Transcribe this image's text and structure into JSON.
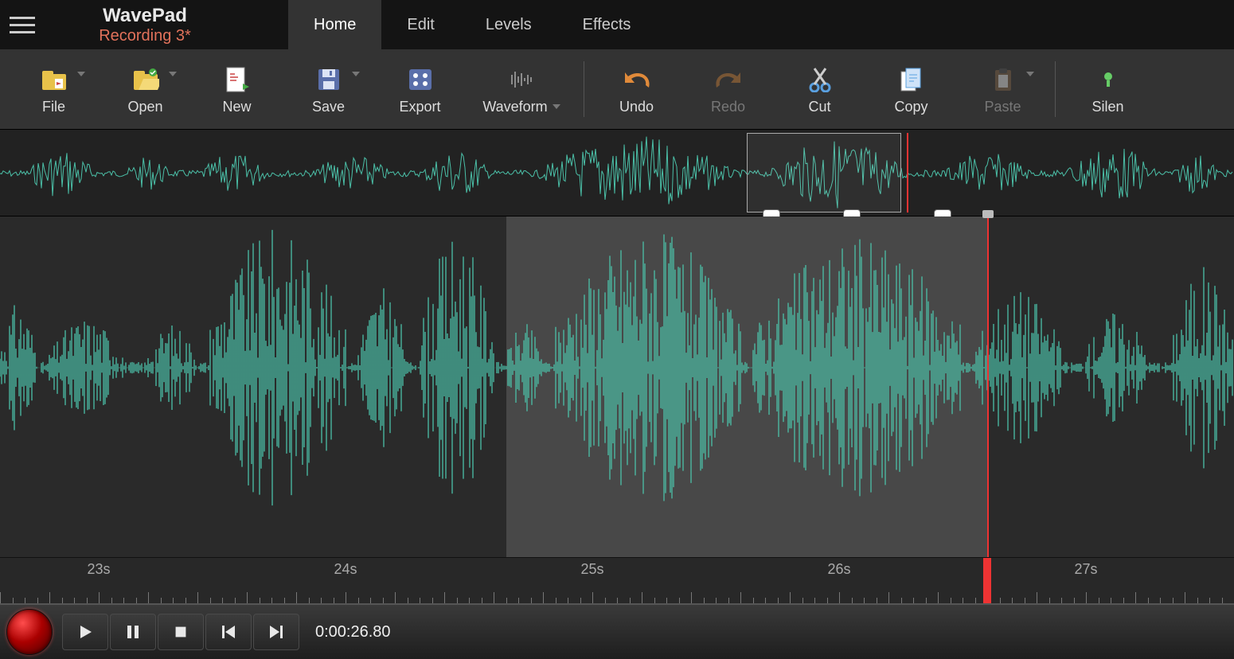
{
  "app": {
    "title": "WavePad",
    "document": "Recording 3*"
  },
  "tabs": [
    {
      "label": "Home",
      "active": true
    },
    {
      "label": "Edit",
      "active": false
    },
    {
      "label": "Levels",
      "active": false
    },
    {
      "label": "Effects",
      "active": false
    }
  ],
  "toolbar": [
    {
      "id": "file",
      "label": "File",
      "icon": "file-icon",
      "dropdown": true,
      "enabled": true
    },
    {
      "id": "open",
      "label": "Open",
      "icon": "open-icon",
      "dropdown": true,
      "enabled": true
    },
    {
      "id": "new",
      "label": "New",
      "icon": "new-icon",
      "dropdown": false,
      "enabled": true
    },
    {
      "id": "save",
      "label": "Save",
      "icon": "save-icon",
      "dropdown": true,
      "enabled": true
    },
    {
      "id": "export",
      "label": "Export",
      "icon": "export-icon",
      "dropdown": false,
      "enabled": true
    },
    {
      "id": "waveform",
      "label": "Waveform",
      "icon": "waveform-icon",
      "dropdown": true,
      "enabled": true,
      "inlineDrop": true
    },
    {
      "sep": true
    },
    {
      "id": "undo",
      "label": "Undo",
      "icon": "undo-icon",
      "dropdown": false,
      "enabled": true
    },
    {
      "id": "redo",
      "label": "Redo",
      "icon": "redo-icon",
      "dropdown": false,
      "enabled": false
    },
    {
      "id": "cut",
      "label": "Cut",
      "icon": "cut-icon",
      "dropdown": false,
      "enabled": true
    },
    {
      "id": "copy",
      "label": "Copy",
      "icon": "copy-icon",
      "dropdown": false,
      "enabled": true
    },
    {
      "id": "paste",
      "label": "Paste",
      "icon": "paste-icon",
      "dropdown": true,
      "enabled": false
    },
    {
      "sep": true
    },
    {
      "id": "silence",
      "label": "Silen",
      "icon": "silence-icon",
      "dropdown": false,
      "enabled": true
    }
  ],
  "overview": {
    "selection_start_pct": 60.5,
    "selection_end_pct": 73.0,
    "handles_pct": [
      62.5,
      69.0,
      76.4
    ],
    "playhead_pct": 73.5
  },
  "main": {
    "selection_start_pct": 41.0,
    "selection_end_pct": 80.0,
    "playhead_pct": 80.0,
    "view_start_s": 22.6,
    "view_end_s": 27.6
  },
  "ruler": {
    "labels": [
      {
        "text": "23s",
        "pct": 8.0
      },
      {
        "text": "24s",
        "pct": 28.0
      },
      {
        "text": "25s",
        "pct": 48.0
      },
      {
        "text": "26s",
        "pct": 68.0
      },
      {
        "text": "27s",
        "pct": 88.0
      }
    ],
    "cursor_pct": 80.0
  },
  "transport": {
    "timecode": "0:00:26.80"
  },
  "colors": {
    "waveform": "#4bc0a8",
    "accent": "#e2725b",
    "playhead": "#e53030"
  }
}
